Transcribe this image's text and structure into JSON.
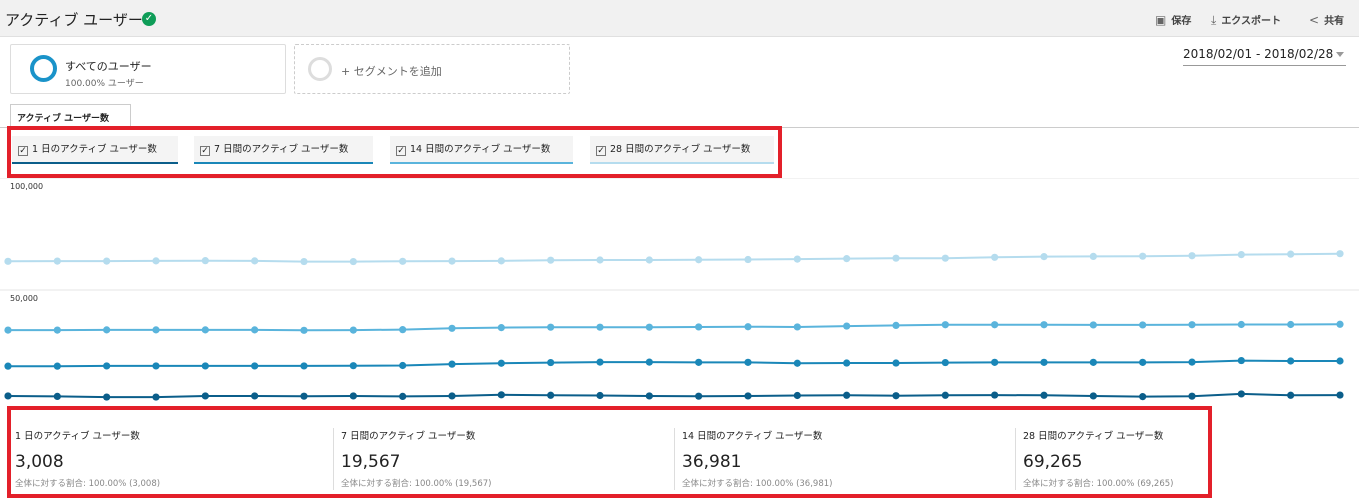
{
  "header": {
    "title": "アクティブ ユーザー",
    "actions": [
      {
        "icon": "save-icon",
        "label": "保存"
      },
      {
        "icon": "download-icon",
        "label": "エクスポート"
      },
      {
        "icon": "share-icon",
        "label": "共有"
      }
    ]
  },
  "segments": {
    "primary": {
      "name": "すべてのユーザー",
      "sub": "100.00% ユーザー"
    },
    "add_label": "+ セグメントを追加"
  },
  "date_range": "2018/02/01 - 2018/02/28",
  "tab_label": "アクティブ ユーザー数",
  "metric_tabs": [
    "1 日のアクティブ ユーザー数",
    "7 日間のアクティブ ユーザー数",
    "14 日間のアクティブ ユーザー数",
    "28 日間のアクティブ ユーザー数"
  ],
  "summary": [
    {
      "name": "1 日のアクティブ ユーザー数",
      "value": "3,008",
      "sub": "全体に対する割合: 100.00% (3,008)"
    },
    {
      "name": "7 日間のアクティブ ユーザー数",
      "value": "19,567",
      "sub": "全体に対する割合: 100.00% (19,567)"
    },
    {
      "name": "14 日間のアクティブ ユーザー数",
      "value": "36,981",
      "sub": "全体に対する割合: 100.00% (36,981)"
    },
    {
      "name": "28 日間のアクティブ ユーザー数",
      "value": "69,265",
      "sub": "全体に対する割合: 100.00% (69,265)"
    }
  ],
  "colors": {
    "s1": "#0b5e8a",
    "s2": "#1a87b8",
    "s3": "#5ab4dc",
    "s4": "#b5dcee",
    "highlight": "#e3202a"
  },
  "chart_data": {
    "type": "line",
    "yticks": [
      "100,000",
      "50,000"
    ],
    "ylim": [
      0,
      100000
    ],
    "x": [
      1,
      2,
      3,
      4,
      5,
      6,
      7,
      8,
      9,
      10,
      11,
      12,
      13,
      14,
      15,
      16,
      17,
      18,
      19,
      20,
      21,
      22,
      23,
      24,
      25,
      26,
      27,
      28
    ],
    "series": [
      {
        "name": "28 日間のアクティブ ユーザー数",
        "values": [
          62800,
          62900,
          62900,
          63000,
          63100,
          63000,
          62700,
          62700,
          62800,
          62900,
          63000,
          63300,
          63400,
          63400,
          63500,
          63600,
          63800,
          64000,
          64200,
          64200,
          64600,
          64900,
          65000,
          65100,
          65300,
          65800,
          66000,
          66200
        ]
      },
      {
        "name": "14 日間のアクティブ ユーザー数",
        "values": [
          32100,
          32100,
          32200,
          32200,
          32200,
          32200,
          32000,
          32100,
          32300,
          32900,
          33200,
          33400,
          33400,
          33400,
          33500,
          33600,
          33500,
          33900,
          34200,
          34500,
          34500,
          34500,
          34400,
          34400,
          34500,
          34600,
          34600,
          34700
        ]
      },
      {
        "name": "7 日間のアクティブ ユーザー数",
        "values": [
          16000,
          16000,
          16100,
          16100,
          16100,
          16100,
          16100,
          16200,
          16300,
          16900,
          17300,
          17600,
          17800,
          17800,
          17700,
          17700,
          17300,
          17400,
          17400,
          17600,
          17700,
          17700,
          17700,
          17700,
          17800,
          18500,
          18300,
          18300
        ]
      },
      {
        "name": "1 日のアクティブ ユーザー数",
        "values": [
          2700,
          2500,
          2200,
          2200,
          2700,
          2700,
          2600,
          2700,
          2500,
          2700,
          3200,
          3000,
          2900,
          2700,
          2600,
          2700,
          2900,
          3000,
          2800,
          3000,
          3100,
          3000,
          2700,
          2400,
          2600,
          3600,
          3000,
          3100
        ]
      }
    ]
  }
}
